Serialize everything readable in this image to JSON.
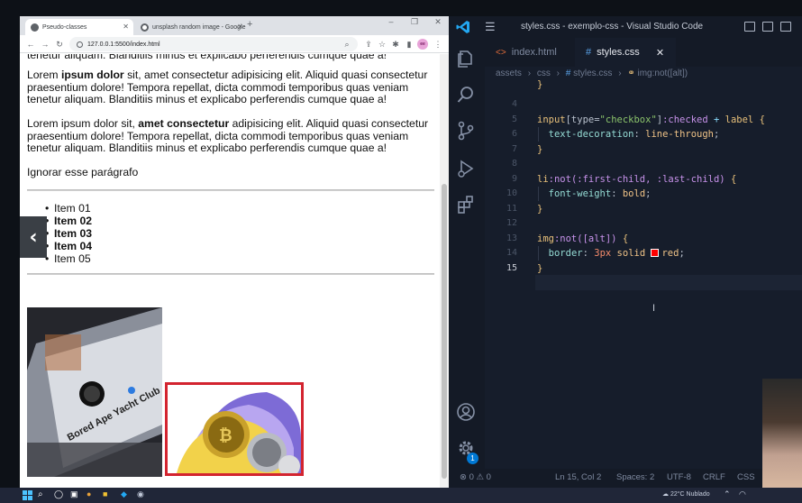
{
  "browser": {
    "tabs": [
      {
        "title": "Pseudo-classes",
        "active": true
      },
      {
        "title": "unsplash random image - Google",
        "active": false
      }
    ],
    "new_tab": "+",
    "controls": {
      "minimize": "–",
      "maximize": "❐",
      "close": "✕"
    },
    "url": "127.0.0.1:5500/index.html",
    "profile_initials": "ee",
    "page": {
      "cut_line": "tenetur aliquam. Blanditiis minus et explicabo perferendis cumque quae a!",
      "paragraph2": {
        "pre": "Lorem ",
        "bold": "ipsum dolor",
        "post": " sit, amet consectetur adipisicing elit. Aliquid quasi consectetur praesentium dolore! Tempora repellat, dicta commodi temporibus quas veniam tenetur aliquam. Blanditiis minus et explicabo perferendis cumque quae a!"
      },
      "paragraph3": {
        "pre": "Lorem ipsum dolor sit, ",
        "bold": "amet consectetur",
        "post": " adipisicing elit. Aliquid quasi consectetur praesentium dolore! Tempora repellat, dicta commodi temporibus quas veniam tenetur aliquam. Blanditiis minus et explicabo perferendis cumque quae a!"
      },
      "ignore_text": "Ignorar esse parágrafo",
      "list": [
        {
          "label": "Item 01",
          "bold": false
        },
        {
          "label": "Item 02",
          "bold": true
        },
        {
          "label": "Item 03",
          "bold": true
        },
        {
          "label": "Item 04",
          "bold": true
        },
        {
          "label": "Item 05",
          "bold": false
        }
      ],
      "image1_text": "Bored Ape Yacht Club",
      "image_border_color": "#d3242f"
    }
  },
  "vscode": {
    "window_title": "styles.css - exemplo-css - Visual Studio Code",
    "tabs": [
      {
        "label": "index.html",
        "active": false
      },
      {
        "label": "styles.css",
        "active": true
      }
    ],
    "tab_close": "✕",
    "breadcrumbs": [
      "assets",
      "css",
      "styles.css",
      "img:not([alt])"
    ],
    "line_numbers": [
      "4",
      "5",
      "6",
      "7",
      "8",
      "9",
      "10",
      "11",
      "12",
      "13",
      "14",
      "15"
    ],
    "current_line": "15",
    "code": {
      "l5_sel": "input",
      "l5_attr": "[type=",
      "l5_str": "\"checkbox\"",
      "l5_attr_end": "]",
      "l5_pseudo": ":checked",
      "l5_op": " + ",
      "l5_sel2": "label",
      "l5_brace": " {",
      "l6_prop": "text-decoration",
      "l6_val": "line-through",
      "l7": "}",
      "l9_sel": "li",
      "l9_pseudo": ":not(:first-child, :last-child)",
      "l9_brace": " {",
      "l10_prop": "font-weight",
      "l10_val": "bold",
      "l11": "}",
      "l13_sel": "img",
      "l13_pseudo": ":not([alt])",
      "l13_brace": " {",
      "l14_prop": "border",
      "l14_num": "3px",
      "l14_solid": "solid",
      "l14_color": "red",
      "l15": "}"
    },
    "status": {
      "problems": "⊗ 0 ⚠ 0",
      "position": "Ln 15, Col 2",
      "spaces": "Spaces: 2",
      "encoding": "UTF-8",
      "eol": "CRLF",
      "language": "CSS"
    },
    "notification_count": "1"
  },
  "taskbar": {
    "weather": "22°C  Nublado"
  },
  "colors": {
    "editor_bg": "#161d2b",
    "accent_blue": "#0078d4",
    "red_swatch": "#ff0000"
  }
}
